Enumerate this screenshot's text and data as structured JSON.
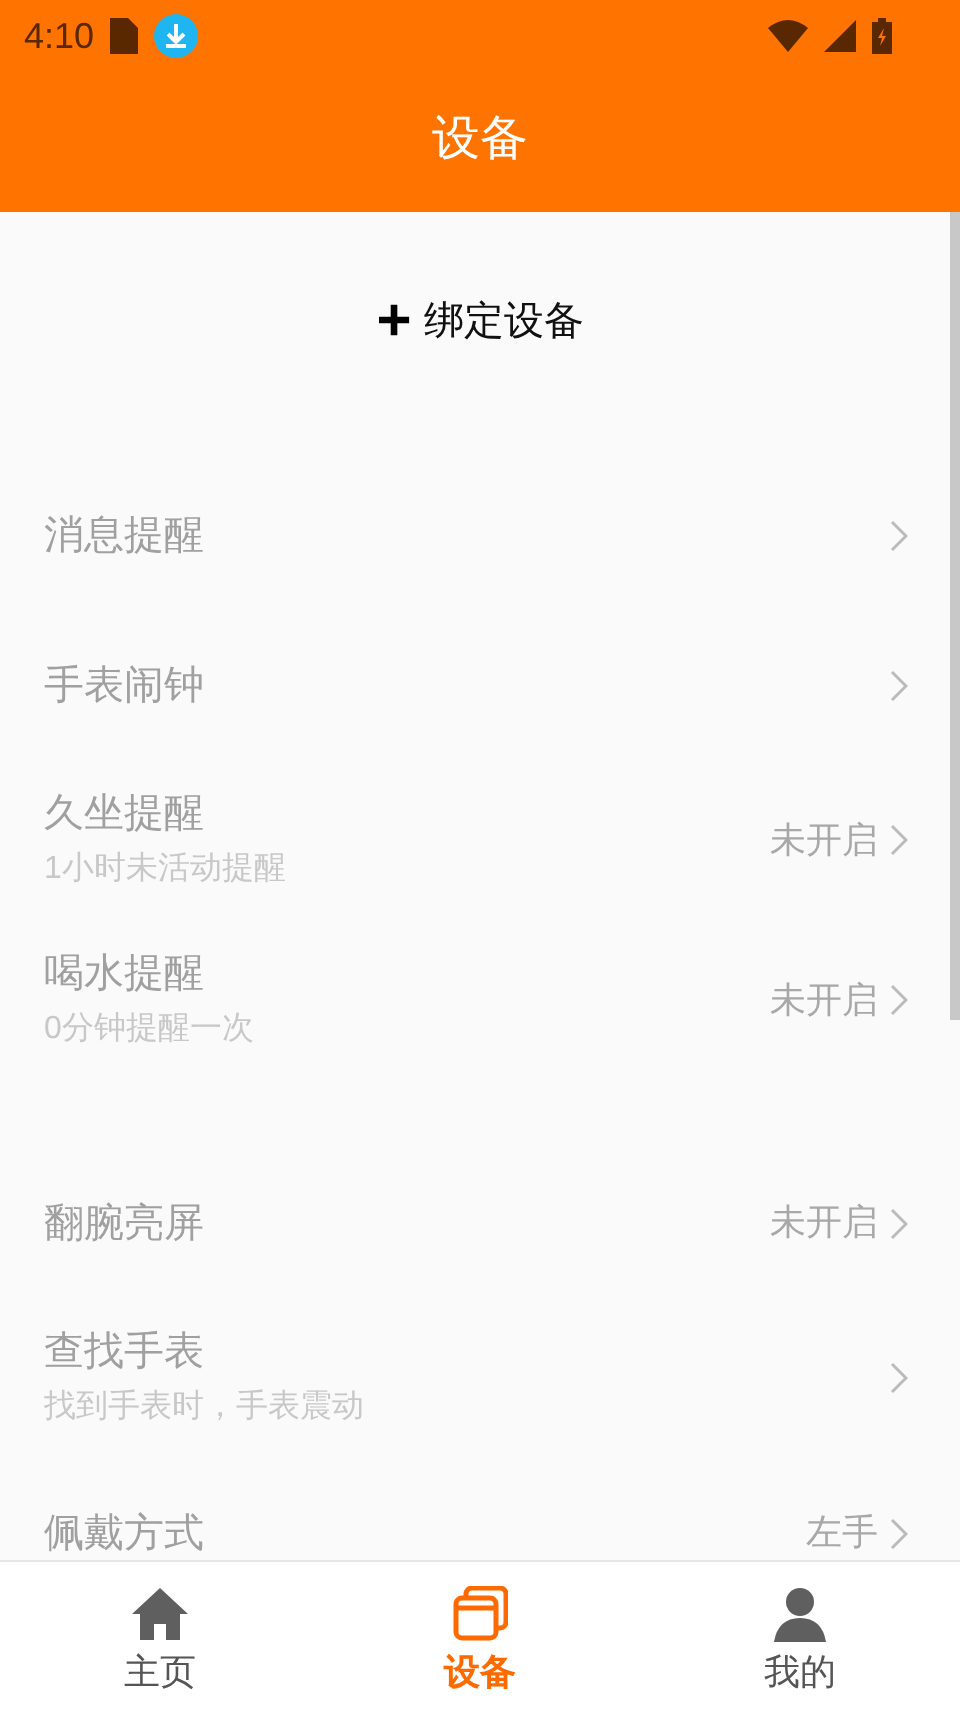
{
  "status_bar": {
    "time": "4:10"
  },
  "header": {
    "title": "设备"
  },
  "bind_button": {
    "icon": "+",
    "label": "绑定设备"
  },
  "groups": [
    [
      {
        "title": "消息提醒"
      },
      {
        "title": "手表闹钟"
      },
      {
        "title": "久坐提醒",
        "subtitle": "1小时未活动提醒",
        "value": "未开启"
      },
      {
        "title": "喝水提醒",
        "subtitle": "0分钟提醒一次",
        "value": "未开启"
      }
    ],
    [
      {
        "title": "翻腕亮屏",
        "value": "未开启"
      },
      {
        "title": "查找手表",
        "subtitle": "找到手表时，手表震动"
      },
      {
        "title": "佩戴方式",
        "value": "左手"
      }
    ]
  ],
  "tabs": [
    {
      "kind": "home",
      "label": "主页",
      "selected": false
    },
    {
      "kind": "device",
      "label": "设备",
      "selected": true
    },
    {
      "kind": "profile",
      "label": "我的",
      "selected": false
    }
  ]
}
